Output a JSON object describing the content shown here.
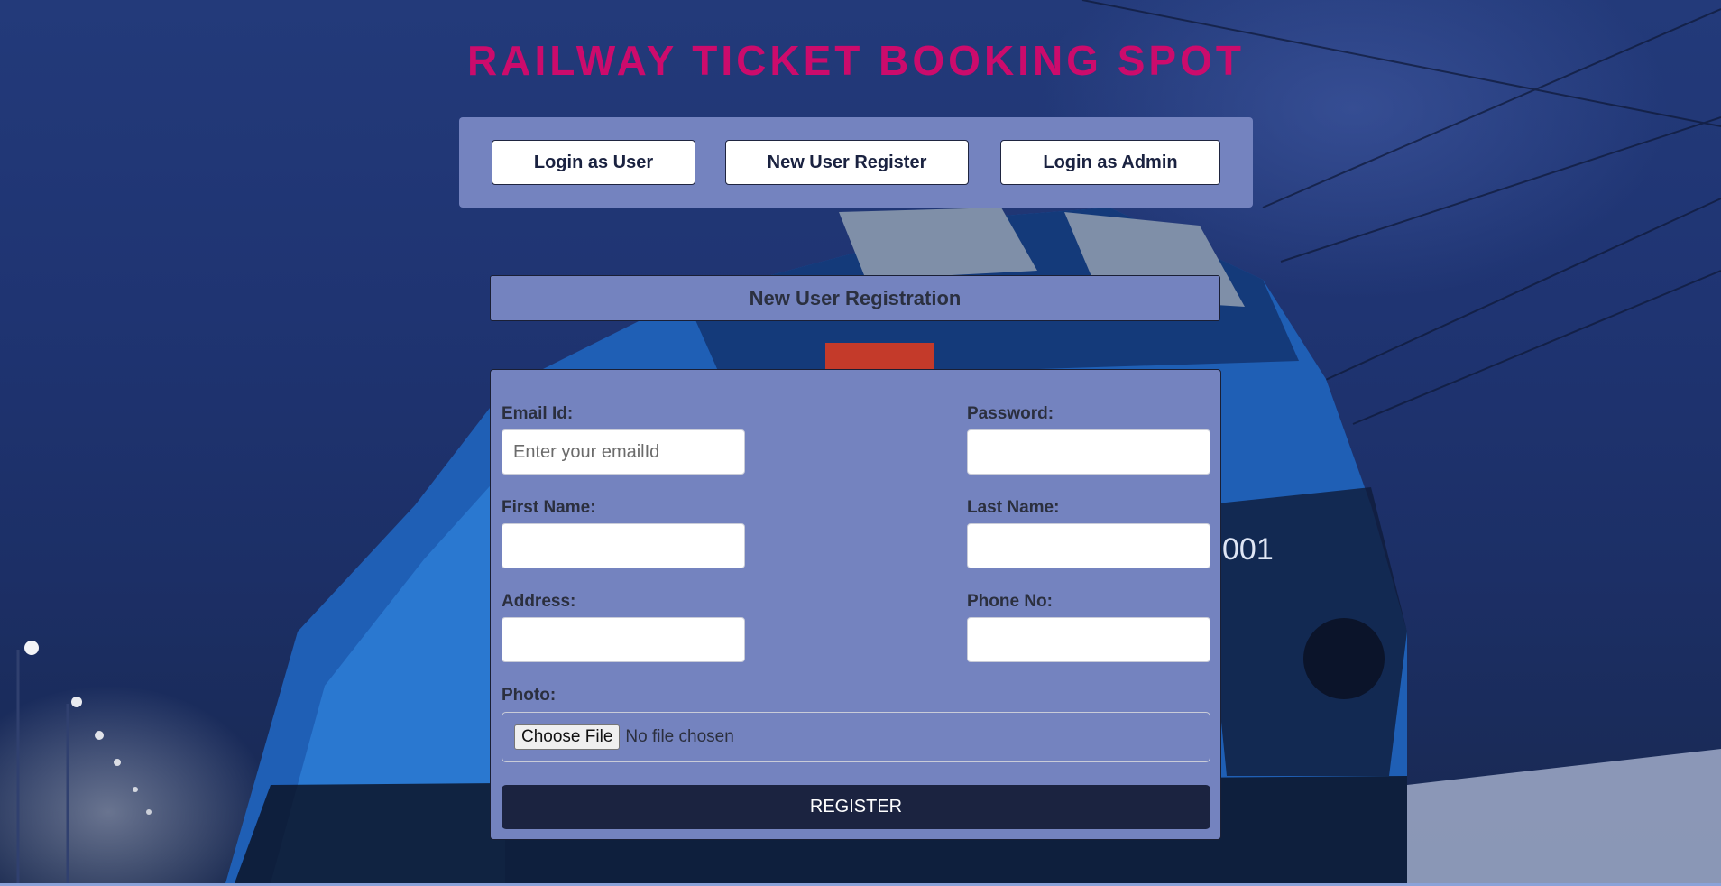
{
  "header": {
    "title": "RAILWAY TICKET BOOKING SPOT"
  },
  "nav": {
    "login_user": "Login as User",
    "new_register": "New User Register",
    "login_admin": "Login as Admin"
  },
  "registration": {
    "heading": "New User Registration",
    "fields": {
      "email": {
        "label": "Email Id:",
        "placeholder": "Enter your emailId",
        "value": ""
      },
      "password": {
        "label": "Password:",
        "value": ""
      },
      "first_name": {
        "label": "First Name:",
        "value": ""
      },
      "last_name": {
        "label": "Last Name:",
        "value": ""
      },
      "address": {
        "label": "Address:",
        "value": ""
      },
      "phone": {
        "label": "Phone No:",
        "value": ""
      },
      "photo": {
        "label": "Photo:",
        "button": "Choose File",
        "status": "No file chosen"
      }
    },
    "submit": "REGISTER"
  },
  "colors": {
    "title": "#cc0b6c",
    "panel": "#7483bf",
    "button_dark": "#1b2340"
  }
}
